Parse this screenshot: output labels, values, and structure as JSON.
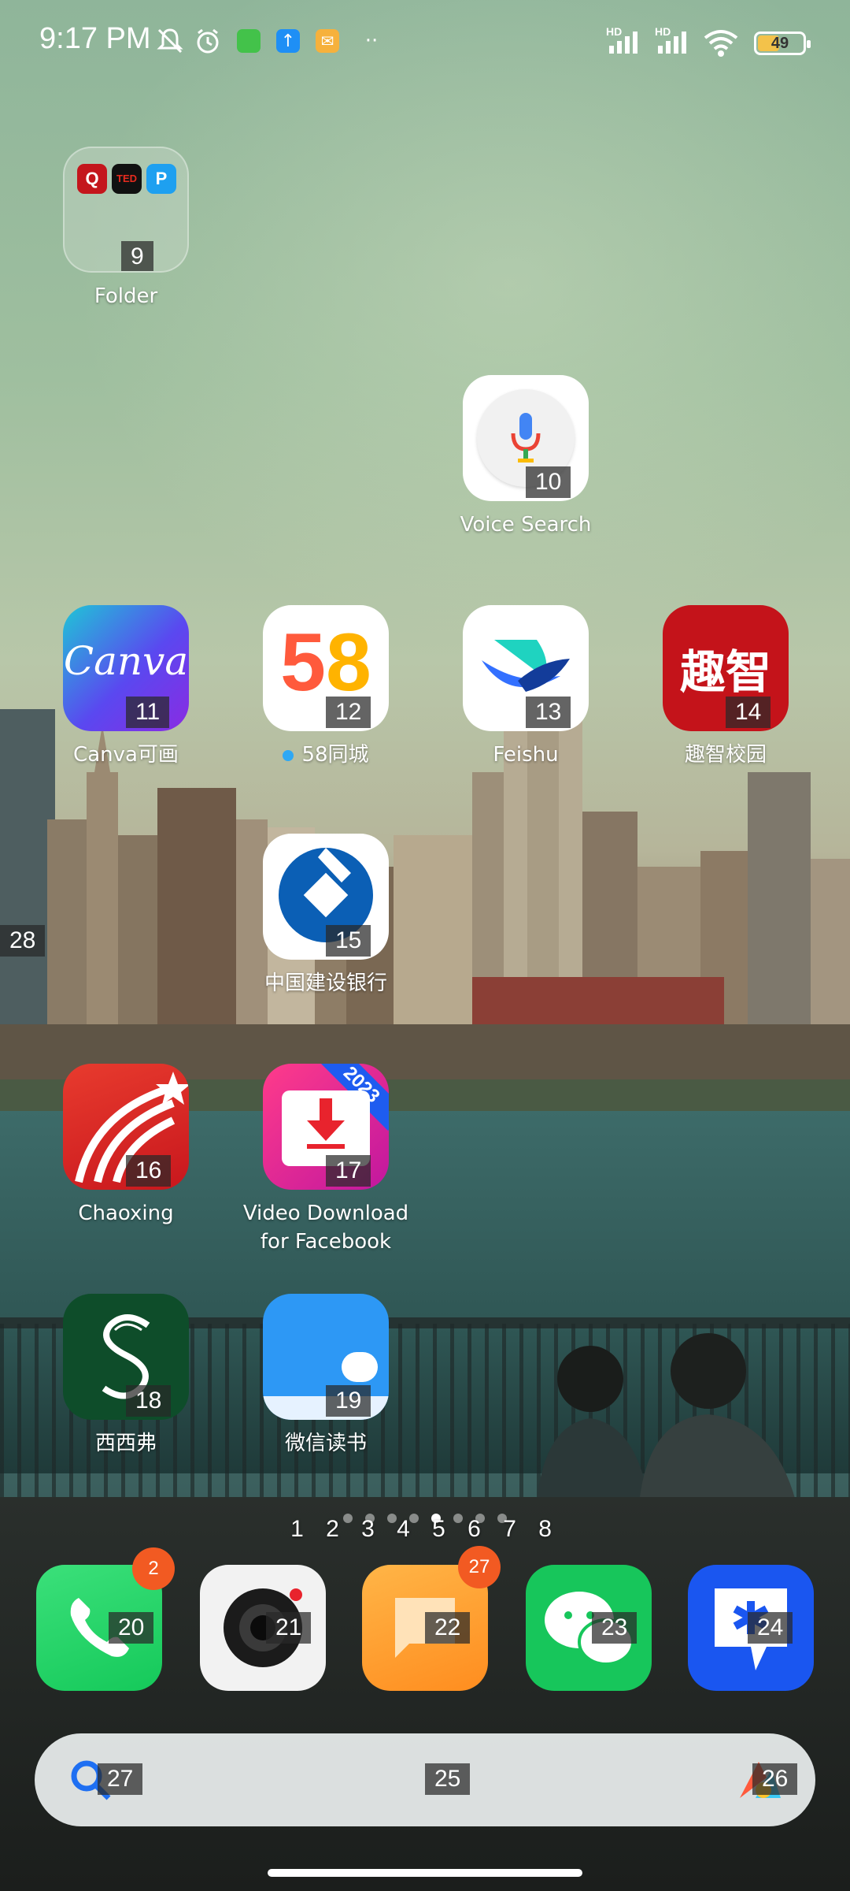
{
  "status_bar": {
    "time": "9:17 PM",
    "left_icons": [
      "bell-off-icon",
      "alarm-icon",
      "green-app-icon",
      "upload-icon",
      "mail-icon",
      "more-dots-icon"
    ],
    "signal_labels": [
      "HD",
      "HD"
    ],
    "battery_percent": 49,
    "battery_text": "49"
  },
  "folder": {
    "label": "Folder",
    "tag": "9",
    "mini_apps": [
      "Q",
      "TED",
      "P"
    ]
  },
  "apps": {
    "voice_search": {
      "label": "Voice Search",
      "tag": "10"
    },
    "canva": {
      "label": "Canva可画",
      "tag": "11",
      "logo": "Canva"
    },
    "tongcheng58": {
      "label": "58同城",
      "tag": "12",
      "logo": "58"
    },
    "feishu": {
      "label": "Feishu",
      "tag": "13"
    },
    "quzhi": {
      "label": "趣智校园",
      "tag": "14",
      "logo": "趣智"
    },
    "ccb": {
      "label": "中国建设银行",
      "tag": "15"
    },
    "chaoxing": {
      "label": "Chaoxing",
      "tag": "16"
    },
    "video_download": {
      "label_line1": "Video Download",
      "label_line2": "for Facebook",
      "tag": "17",
      "ribbon": "2023"
    },
    "xixifu": {
      "label": "西西弗",
      "tag": "18"
    },
    "weixin_dushu": {
      "label": "微信读书",
      "tag": "19"
    }
  },
  "left_edge_tag": "28",
  "page_indicator": {
    "numbers": "1 2 3 4 5 6 7 8",
    "active_index": 4
  },
  "dock": {
    "phone": {
      "tag": "20",
      "badge": "2"
    },
    "camera": {
      "tag": "21"
    },
    "messages": {
      "tag": "22",
      "badge": "27"
    },
    "wechat": {
      "tag": "23"
    },
    "dingtalk": {
      "tag": "24"
    }
  },
  "search_bar": {
    "center_tag": "25",
    "right_tag": "26",
    "left_tag": "27"
  },
  "colors": {
    "badge": "#f25a22",
    "battery_fill": "#f3c24a"
  }
}
